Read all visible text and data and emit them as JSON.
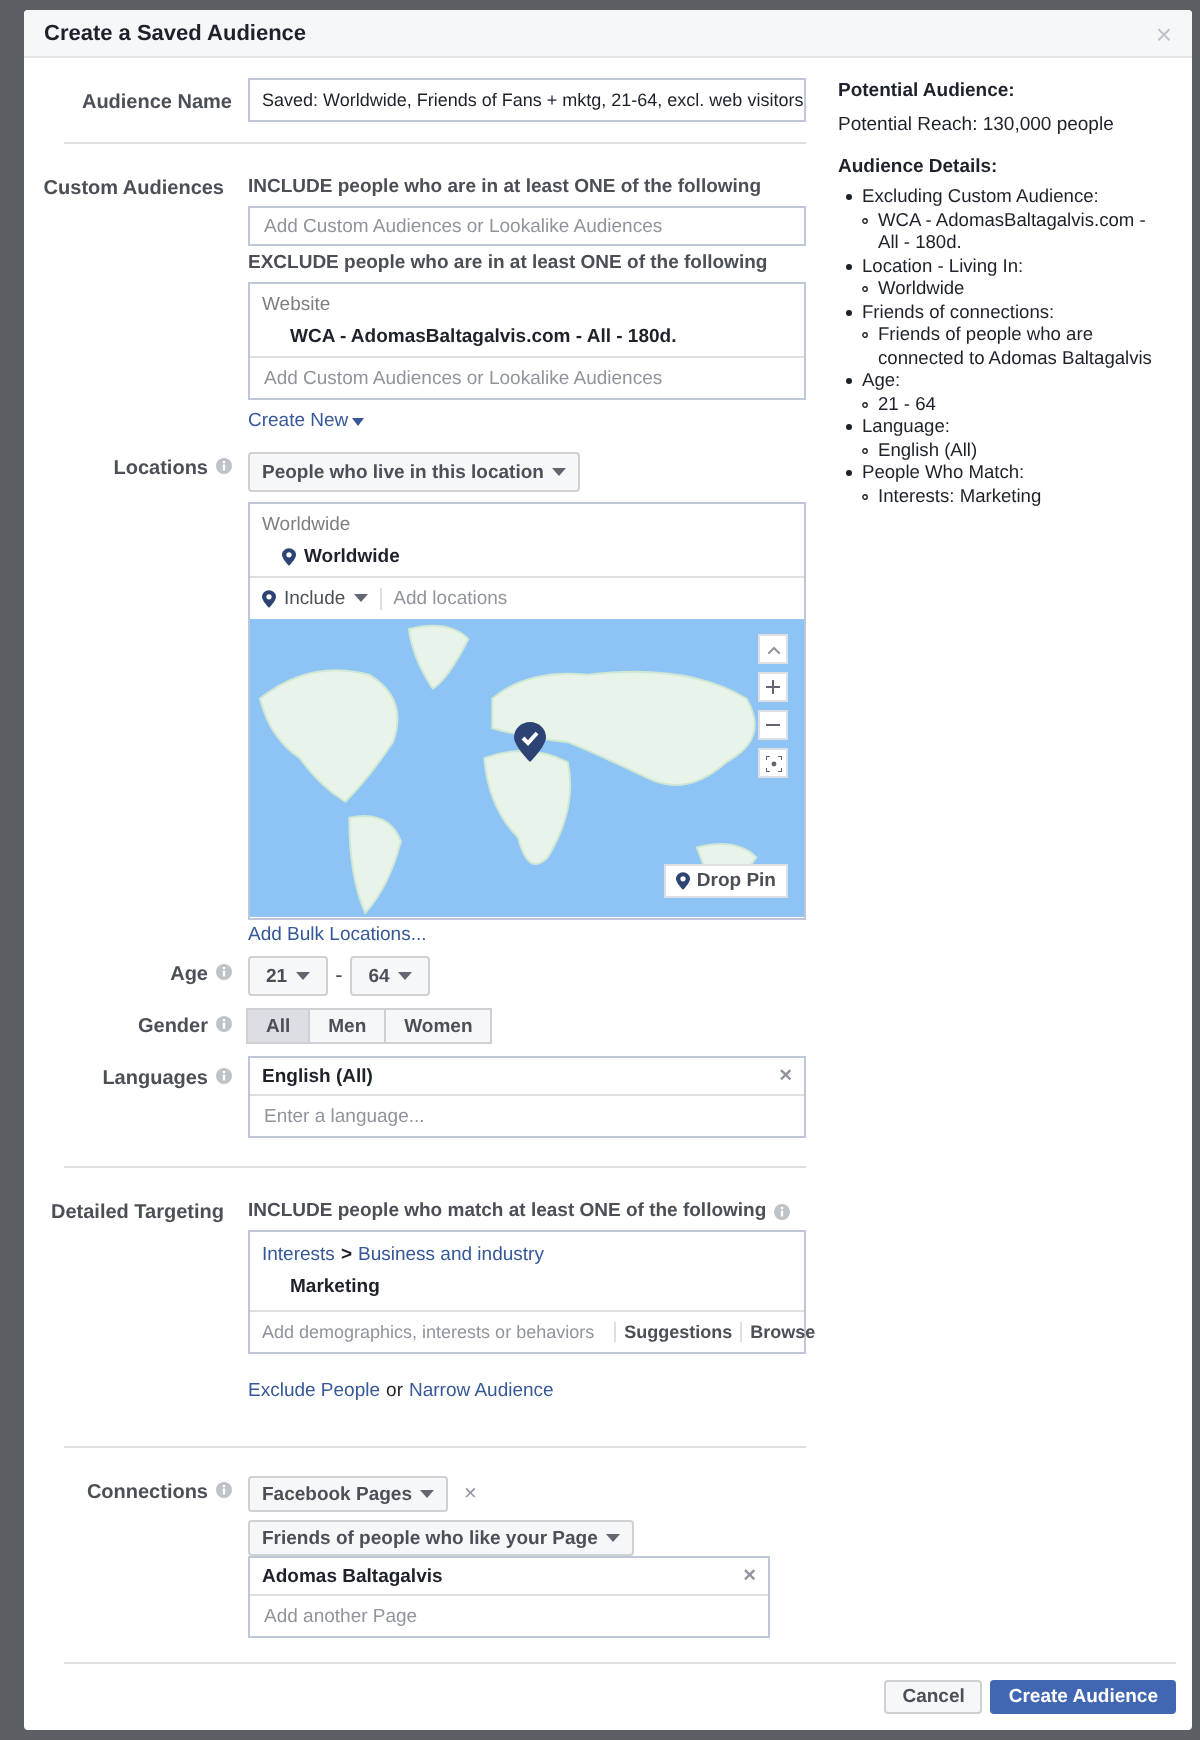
{
  "dialog": {
    "title": "Create a Saved Audience",
    "close": "×"
  },
  "audience_name": {
    "label": "Audience Name",
    "value": "Saved: Worldwide, Friends of Fans + mktg, 21-64, excl. web visitors"
  },
  "custom_audiences": {
    "label": "Custom Audiences",
    "include_heading": "INCLUDE people who are in at least ONE of the following",
    "include_placeholder": "Add Custom Audiences or Lookalike Audiences",
    "exclude_heading": "EXCLUDE people who are in at least ONE of the following",
    "exclude_group": "Website",
    "exclude_items": [
      "WCA - AdomasBaltagalvis.com - All - 180d."
    ],
    "exclude_placeholder": "Add Custom Audiences or Lookalike Audiences",
    "create_new": "Create New"
  },
  "locations": {
    "label": "Locations",
    "type_dropdown": "People who live in this location",
    "group": "Worldwide",
    "items": [
      "Worldwide"
    ],
    "mode": "Include",
    "placeholder": "Add locations",
    "drop_pin": "Drop Pin",
    "bulk_link": "Add Bulk Locations..."
  },
  "age": {
    "label": "Age",
    "min": "21",
    "separator": "-",
    "max": "64"
  },
  "gender": {
    "label": "Gender",
    "options": [
      {
        "label": "All",
        "selected": true
      },
      {
        "label": "Men",
        "selected": false
      },
      {
        "label": "Women",
        "selected": false
      }
    ]
  },
  "languages": {
    "label": "Languages",
    "items": [
      {
        "label": "English (All)",
        "remove": "×"
      }
    ],
    "placeholder": "Enter a language..."
  },
  "detailed_targeting": {
    "label": "Detailed Targeting",
    "heading": "INCLUDE people who match at least ONE of the following",
    "path": [
      "Interests",
      "Business and industry"
    ],
    "path_separator": ">",
    "items": [
      "Marketing"
    ],
    "placeholder": "Add demographics, interests or behaviors",
    "actions": [
      "Suggestions",
      "Browse"
    ],
    "exclude_link": "Exclude People",
    "or": "or",
    "narrow_link": "Narrow Audience"
  },
  "connections": {
    "label": "Connections",
    "type_dropdown": "Facebook Pages",
    "remove": "×",
    "relation_dropdown": "Friends of people who like your Page",
    "pages": [
      {
        "label": "Adomas Baltagalvis",
        "remove": "×"
      }
    ],
    "placeholder": "Add another Page"
  },
  "summary": {
    "potential_heading": "Potential Audience:",
    "reach": "Potential Reach: 130,000 people",
    "details_heading": "Audience Details:",
    "details": [
      {
        "text": "Excluding Custom Audience:",
        "children": [
          {
            "text": "WCA - AdomasBaltagalvis.com - All - 180d."
          }
        ]
      },
      {
        "text": "Location - Living In:",
        "children": [
          {
            "text": "Worldwide"
          }
        ]
      },
      {
        "text": "Friends of connections:",
        "children": [
          {
            "text": "Friends of people who are connected to Adomas Baltagalvis"
          }
        ]
      },
      {
        "text": "Age:",
        "children": [
          {
            "text": "21 - 64"
          }
        ]
      },
      {
        "text": "Language:",
        "children": [
          {
            "text": "English (All)"
          }
        ]
      },
      {
        "text": "People Who Match:",
        "children": [
          {
            "text": "Interests: Marketing"
          }
        ]
      }
    ]
  },
  "footer": {
    "buttons": [
      {
        "label": "Cancel",
        "kind": "secondary"
      },
      {
        "label": "Create Audience",
        "kind": "primary"
      }
    ]
  }
}
